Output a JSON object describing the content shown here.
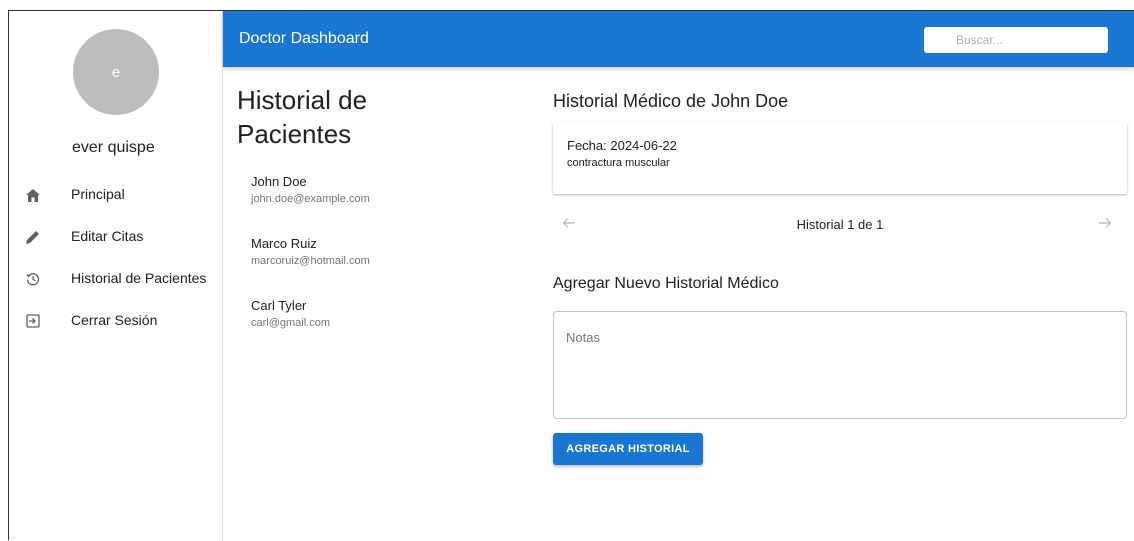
{
  "sidebar": {
    "avatar_initial": "e",
    "user_name": "ever quispe",
    "items": [
      {
        "label": "Principal",
        "icon": "home-icon"
      },
      {
        "label": "Editar Citas",
        "icon": "pencil-icon"
      },
      {
        "label": "Historial de Pacientes",
        "icon": "history-icon"
      },
      {
        "label": "Cerrar Sesión",
        "icon": "logout-icon"
      }
    ]
  },
  "topbar": {
    "title": "Doctor Dashboard",
    "search_placeholder": "Buscar..."
  },
  "patients": {
    "title": "Historial de Pacientes",
    "list": [
      {
        "name": "John Doe",
        "email": "john.doe@example.com"
      },
      {
        "name": "Marco Ruiz",
        "email": "marcoruiz@hotmail.com"
      },
      {
        "name": "Carl Tyler",
        "email": "carl@gmail.com"
      }
    ]
  },
  "history": {
    "title": "Historial Médico de John Doe",
    "record": {
      "date": "Fecha: 2024-06-22",
      "notes": "contractura muscular"
    },
    "pager_text": "Historial 1 de 1"
  },
  "new_record": {
    "title": "Agregar Nuevo Historial Médico",
    "notes_placeholder": "Notas",
    "submit_label": "AGREGAR HISTORIAL"
  },
  "colors": {
    "primary": "#1976d2",
    "avatar_bg": "#bdbdbd"
  }
}
